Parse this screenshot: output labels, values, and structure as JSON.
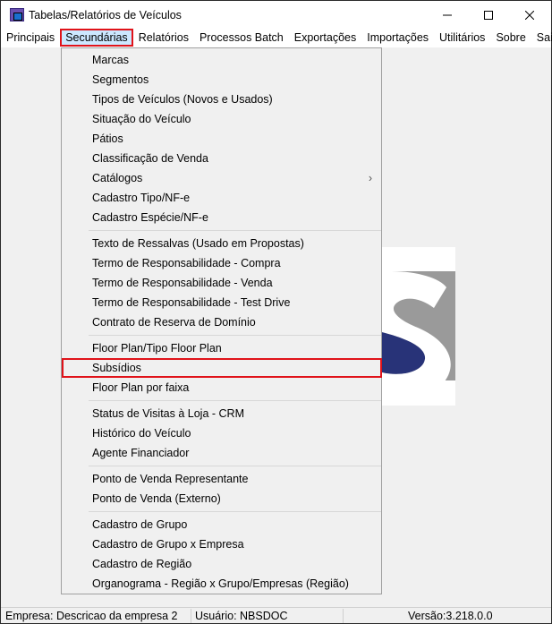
{
  "window": {
    "title": "Tabelas/Relatórios de Veículos",
    "controls": [
      "minimize",
      "maximize",
      "close"
    ]
  },
  "menubar": {
    "items": [
      "Principais",
      "Secundárias",
      "Relatórios",
      "Processos Batch",
      "Exportações",
      "Importações",
      "Utilitários",
      "Sobre",
      "Sair"
    ],
    "active": "Secundárias"
  },
  "dropdown": {
    "groups": [
      [
        "Marcas",
        "Segmentos",
        "Tipos de Veículos (Novos e Usados)",
        "Situação do Veículo",
        "Pátios",
        "Classificação de Venda",
        "Catálogos",
        "Cadastro Tipo/NF-e",
        "Cadastro Espécie/NF-e"
      ],
      [
        "Texto de Ressalvas (Usado em Propostas)",
        "Termo de Responsabilidade - Compra",
        "Termo de Responsabilidade - Venda",
        "Termo de Responsabilidade - Test Drive",
        "Contrato de Reserva de Domínio"
      ],
      [
        "Floor Plan/Tipo Floor Plan",
        "Subsídios",
        "Floor Plan por faixa"
      ],
      [
        "Status de Visitas à Loja - CRM",
        "Histórico do Veículo",
        "Agente Financiador"
      ],
      [
        "Ponto de Venda Representante",
        "Ponto de Venda (Externo)"
      ],
      [
        "Cadastro de Grupo",
        "Cadastro de Grupo x Empresa",
        "Cadastro de Região",
        "Organograma - Região x Grupo/Empresas (Região)"
      ]
    ],
    "submenu_items": [
      "Catálogos"
    ],
    "highlighted": "Subsídios"
  },
  "status": {
    "empresa": "Empresa: Descricao da empresa 2",
    "usuario": "Usuário: NBSDOC",
    "versao": "Versão:3.218.0.0"
  },
  "colors": {
    "highlight": "#e0131a",
    "active_menu": "#cce8ff",
    "logo_navy": "#283378",
    "logo_gray": "#9a9a9a"
  }
}
